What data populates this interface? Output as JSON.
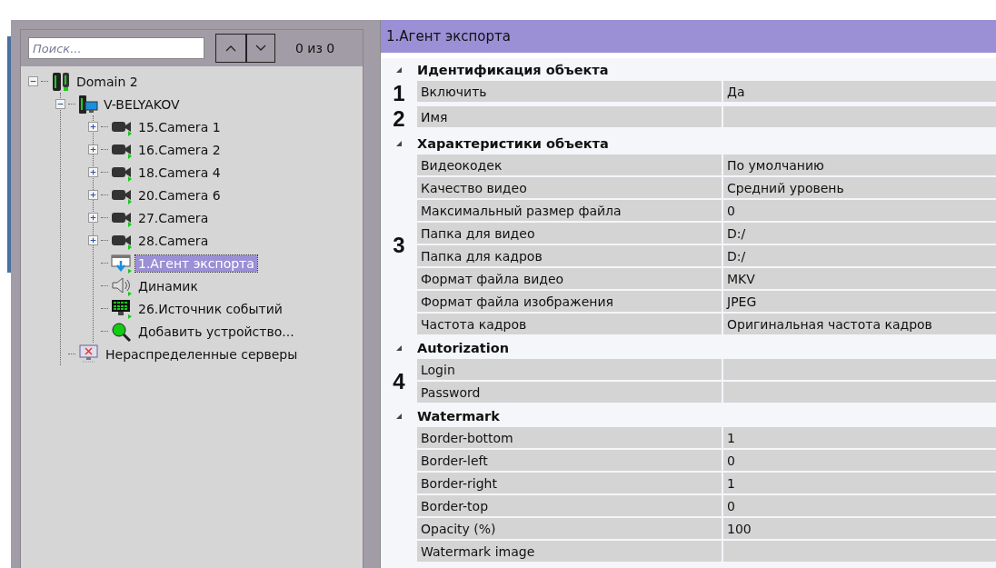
{
  "search": {
    "placeholder": "Поиск...",
    "count": "0 из 0"
  },
  "tree": [
    {
      "kind": "domain",
      "label": "Domain 2",
      "expanded": true,
      "selected": false,
      "children": [
        {
          "kind": "server",
          "label": "V-BELYAKOV",
          "expanded": true,
          "selected": false,
          "children": [
            {
              "kind": "camera",
              "label": "15.Camera 1",
              "expanded": false,
              "selected": false
            },
            {
              "kind": "camera",
              "label": "16.Camera 2",
              "expanded": false,
              "selected": false
            },
            {
              "kind": "camera",
              "label": "18.Camera 4",
              "expanded": false,
              "selected": false
            },
            {
              "kind": "camera",
              "label": "20.Camera 6",
              "expanded": false,
              "selected": false
            },
            {
              "kind": "camera",
              "label": "27.Camera",
              "expanded": false,
              "selected": false
            },
            {
              "kind": "camera",
              "label": "28.Camera",
              "expanded": false,
              "selected": false
            },
            {
              "kind": "export",
              "label": "1.Агент экспорта",
              "selected": true
            },
            {
              "kind": "speaker",
              "label": "Динамик",
              "selected": false
            },
            {
              "kind": "events",
              "label": "26.Источник событий",
              "selected": false
            },
            {
              "kind": "add",
              "label": "Добавить устройство...",
              "selected": false
            }
          ]
        },
        {
          "kind": "unassigned",
          "label": "Нераспределенные серверы",
          "selected": false
        }
      ]
    }
  ],
  "properties": {
    "title": "1.Агент экспорта",
    "groups": [
      {
        "title": "Идентификация объекта",
        "expanded": true,
        "blocks": [
          {
            "marker": "1",
            "rows": [
              {
                "name": "Включить",
                "value": "Да"
              }
            ]
          },
          {
            "marker": "2",
            "rows": [
              {
                "name": "Имя"
              }
            ]
          }
        ]
      },
      {
        "title": "Характеристики объекта",
        "expanded": true,
        "blocks": [
          {
            "marker": "3",
            "rows": [
              {
                "name": "Видеокодек",
                "value": "По умолчанию"
              },
              {
                "name": "Качество видео",
                "value": "Средний уровень"
              },
              {
                "name": "Максимальный размер файла",
                "value": "0"
              },
              {
                "name": "Папка для видео",
                "value": "D:/"
              },
              {
                "name": "Папка для кадров",
                "value": "D:/"
              },
              {
                "name": "Формат файла видео",
                "value": "MKV"
              },
              {
                "name": "Формат файла изображения",
                "value": "JPEG"
              },
              {
                "name": "Частота кадров",
                "value": "Оригинальная частота кадров"
              }
            ]
          }
        ]
      },
      {
        "title": "Autorization",
        "expanded": true,
        "blocks": [
          {
            "marker": "4",
            "rows": [
              {
                "name": "Login"
              },
              {
                "name": "Password"
              }
            ]
          }
        ]
      },
      {
        "title": "Watermark",
        "expanded": true,
        "blocks": [
          {
            "rows": [
              {
                "name": "Border-bottom",
                "value": "1"
              },
              {
                "name": "Border-left",
                "value": "0"
              },
              {
                "name": "Border-right",
                "value": "1"
              },
              {
                "name": "Border-top",
                "value": "0"
              },
              {
                "name": "Opacity (%)",
                "value": "100"
              },
              {
                "name": "Watermark image"
              }
            ]
          }
        ]
      }
    ]
  }
}
